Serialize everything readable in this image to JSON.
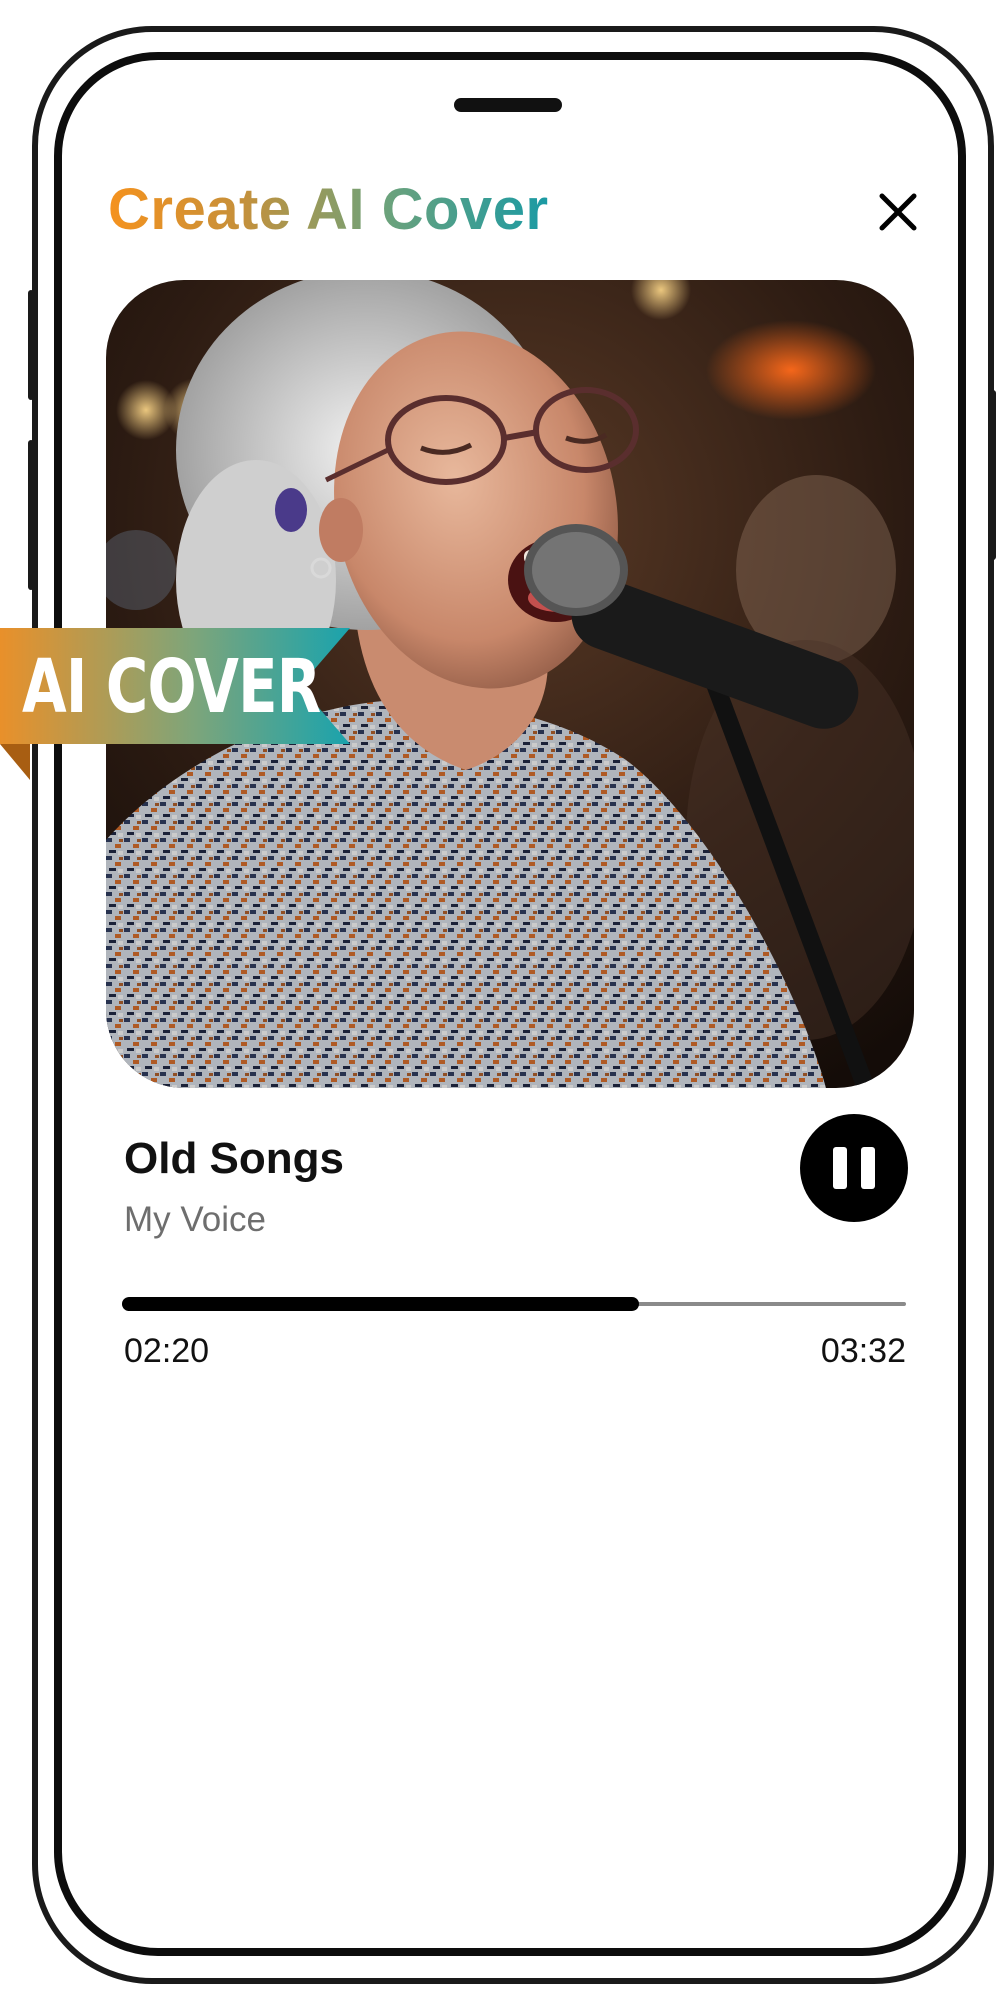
{
  "app": {
    "title": "Create AI Cover"
  },
  "icons": {
    "close": "close-icon",
    "pause": "pause-icon"
  },
  "artwork": {
    "badge_text": "AI COVER"
  },
  "player": {
    "track_title": "Old Songs",
    "track_subtitle": "My Voice",
    "elapsed": "02:20",
    "duration": "03:32",
    "progress_fraction": 0.66
  },
  "colors": {
    "title_gradient": [
      "#f5921e",
      "#c6903a",
      "#6ea27a",
      "#1a9aa4"
    ],
    "ribbon_gradient": [
      "#e9902a",
      "#7ea57a",
      "#1aa3ad"
    ],
    "accent": "#000000"
  }
}
